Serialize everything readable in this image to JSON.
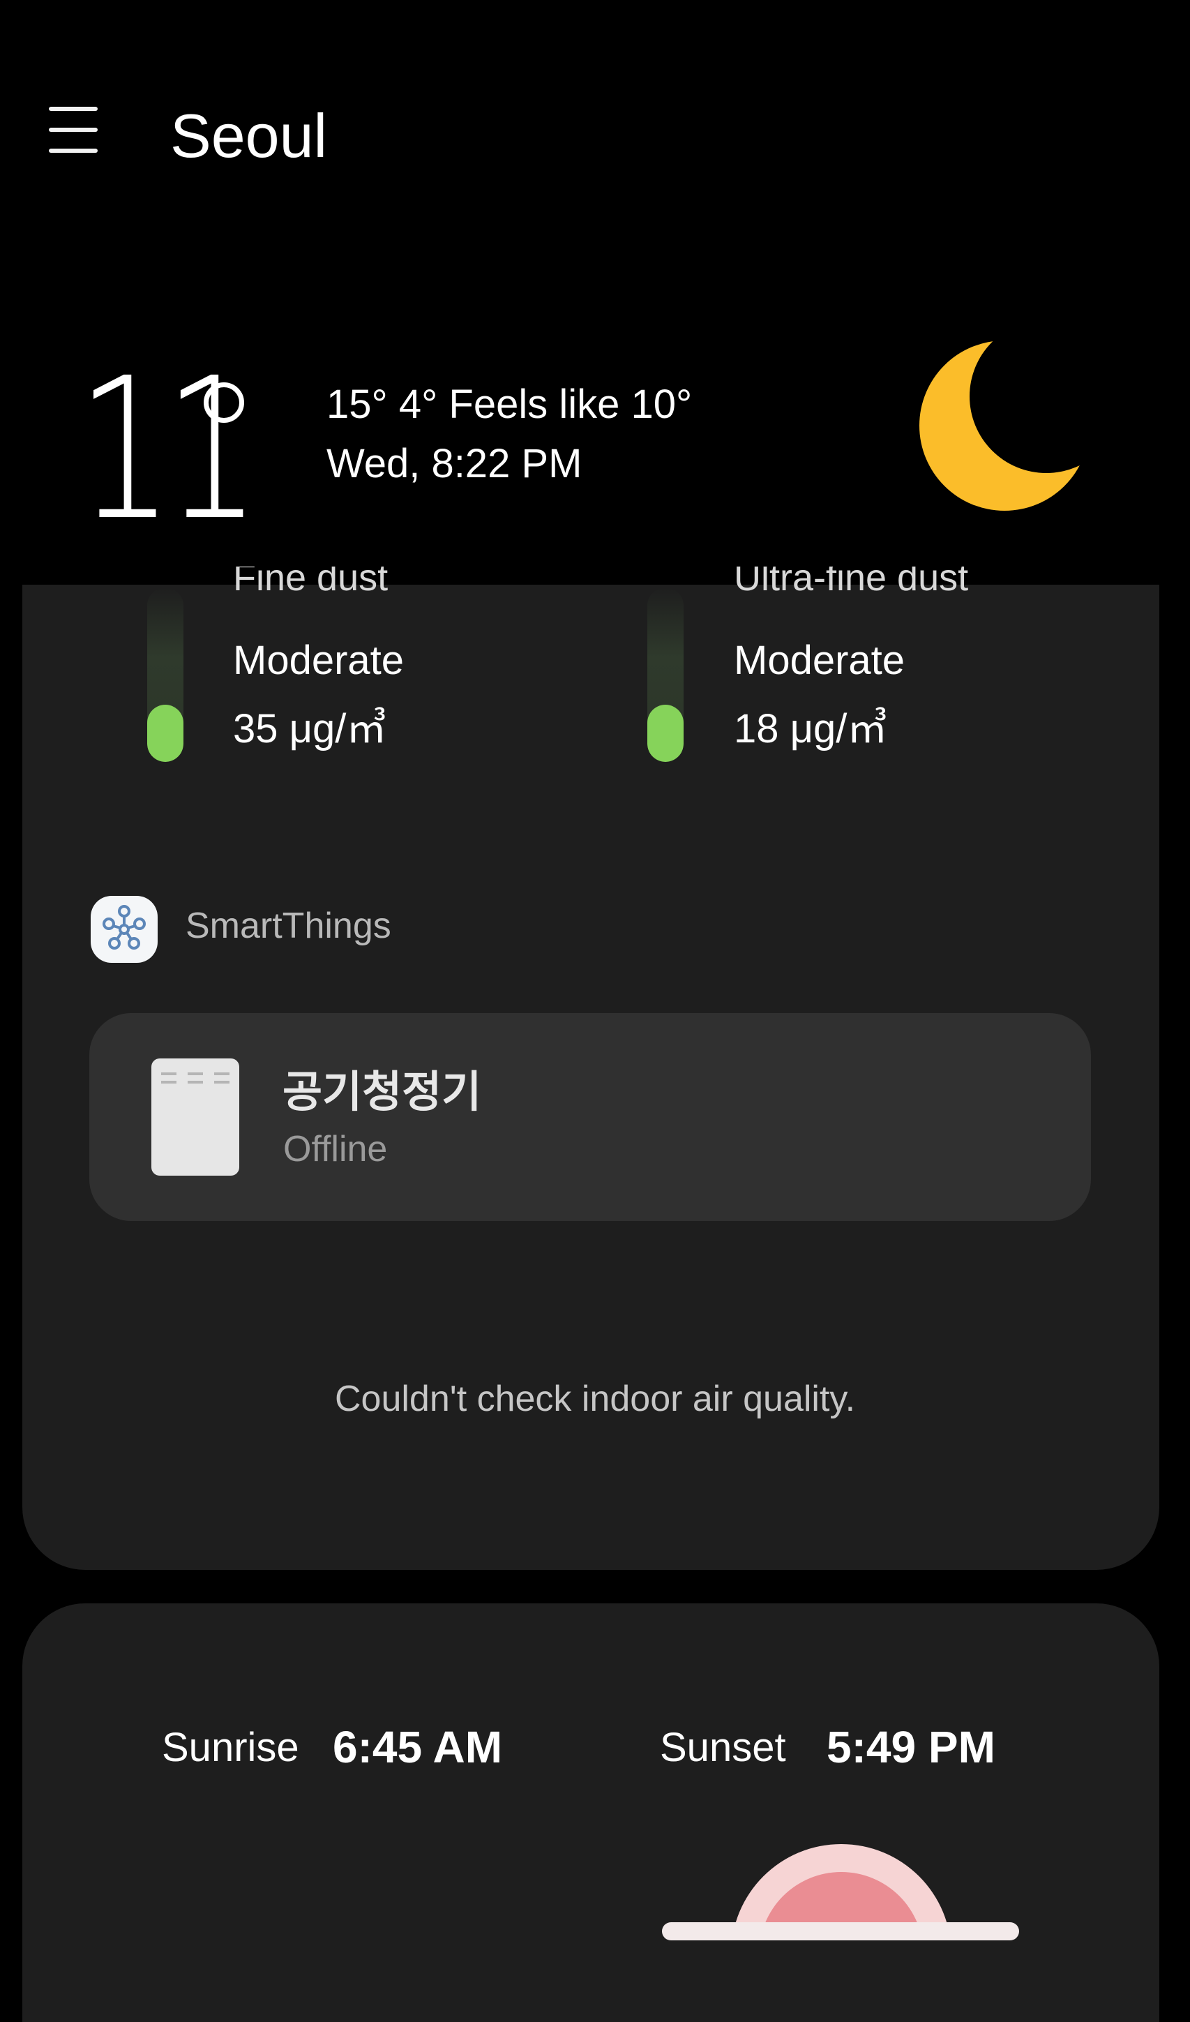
{
  "header": {
    "city": "Seoul"
  },
  "current": {
    "temperature": "11",
    "hi_lo_feels": "15° 4° Feels like 10°",
    "datetime": "Wed, 8:22 PM",
    "condition_icon": "crescent-moon-icon",
    "moon_color": "#fbbd2a"
  },
  "air_quality": {
    "fine_dust": {
      "label": "Fine dust",
      "level": "Moderate",
      "value": "35 μg/㎥",
      "bar_fill_fraction": 0.33
    },
    "ultra_fine_dust": {
      "label": "Ultra-fine dust",
      "level": "Moderate",
      "value": "18 μg/㎥",
      "bar_fill_fraction": 0.33
    },
    "bar_color": "#86d35a"
  },
  "smartthings": {
    "label": "SmartThings",
    "icon": "smartthings-icon",
    "device": {
      "name": "공기청정기",
      "status": "Offline",
      "icon": "air-purifier-icon"
    },
    "indoor_message": "Couldn't check indoor air quality."
  },
  "sun": {
    "sunrise_label": "Sunrise",
    "sunrise_time": "6:45 AM",
    "sunset_label": "Sunset",
    "sunset_time": "5:49 PM",
    "graphic_icon": "sun-position-icon"
  }
}
